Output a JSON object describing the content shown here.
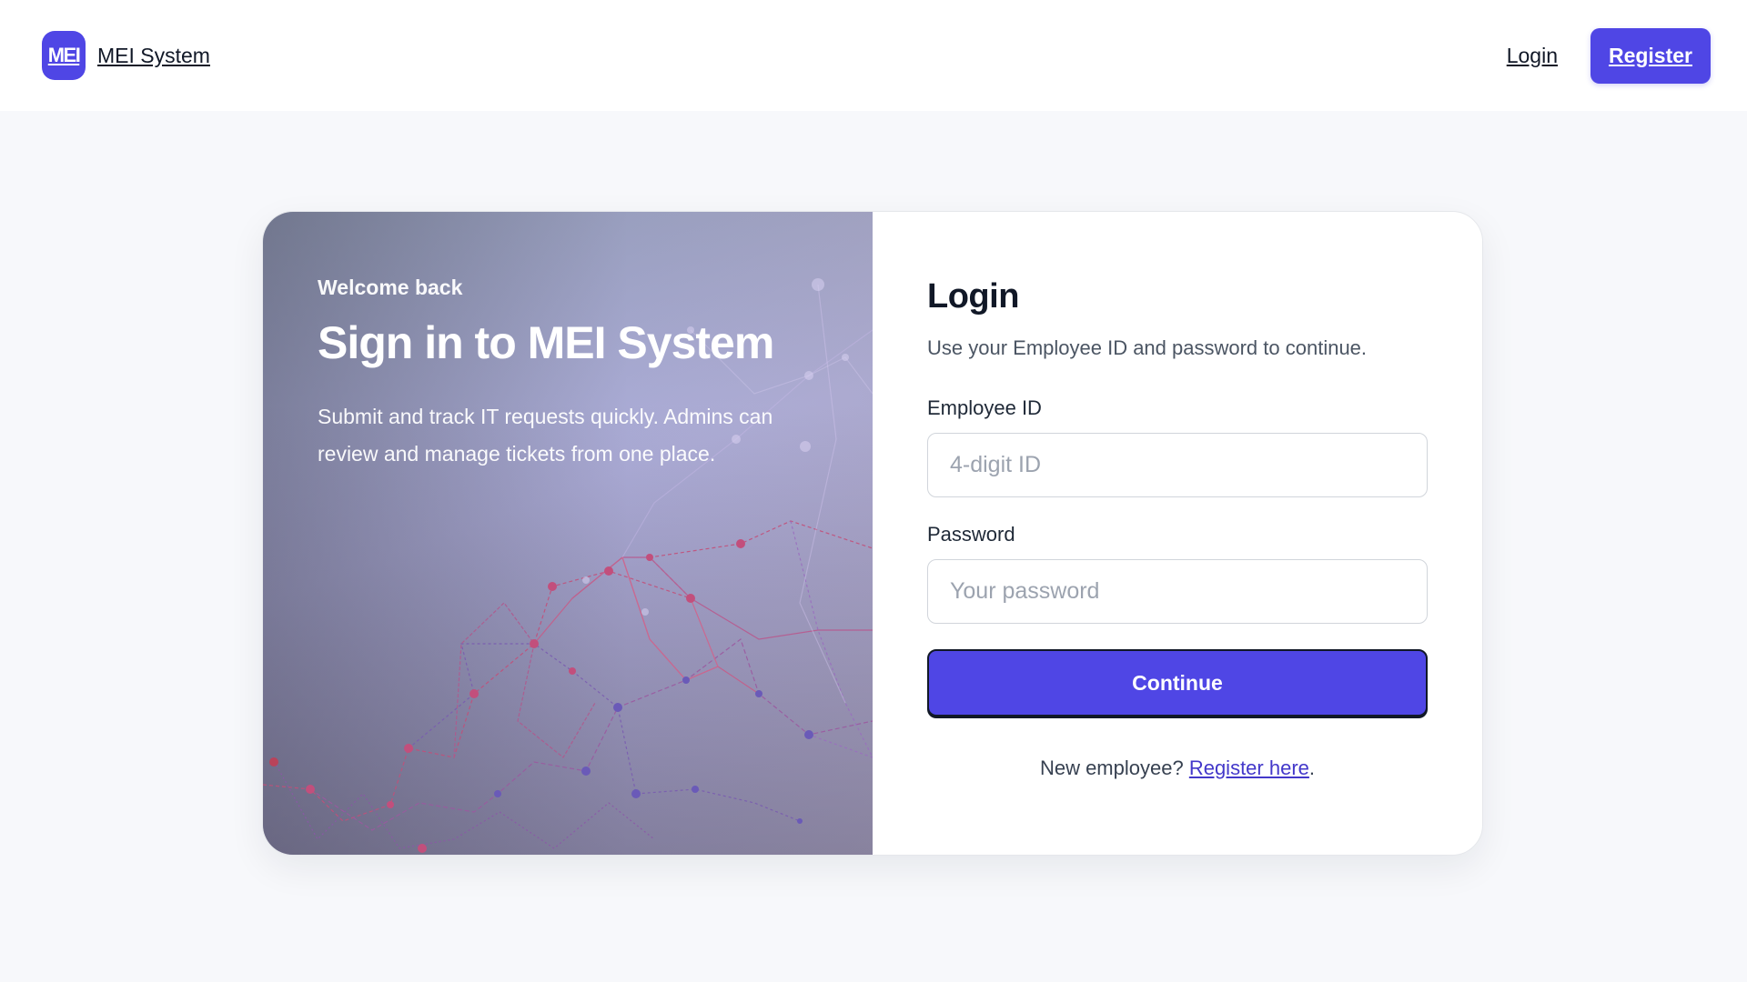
{
  "brand": {
    "logo_text": "MEI",
    "name": "MEI System"
  },
  "nav": {
    "login_label": "Login",
    "register_label": "Register"
  },
  "hero": {
    "eyebrow": "Welcome back",
    "title": "Sign in to MEI System",
    "description": "Submit and track IT requests quickly. Admins can review and manage tickets from one place."
  },
  "form": {
    "title": "Login",
    "subtitle": "Use your Employee ID and password to continue.",
    "employee_id": {
      "label": "Employee ID",
      "value": "",
      "placeholder": "4-digit ID"
    },
    "password": {
      "label": "Password",
      "value": "",
      "placeholder": "Your password"
    },
    "submit_label": "Continue",
    "footer_prefix": "New employee? ",
    "footer_link": "Register here",
    "footer_suffix": "."
  },
  "colors": {
    "accent": "#4f46e5",
    "page_bg": "#f7f8fb",
    "card_bg": "#ffffff",
    "text": "#111827"
  }
}
